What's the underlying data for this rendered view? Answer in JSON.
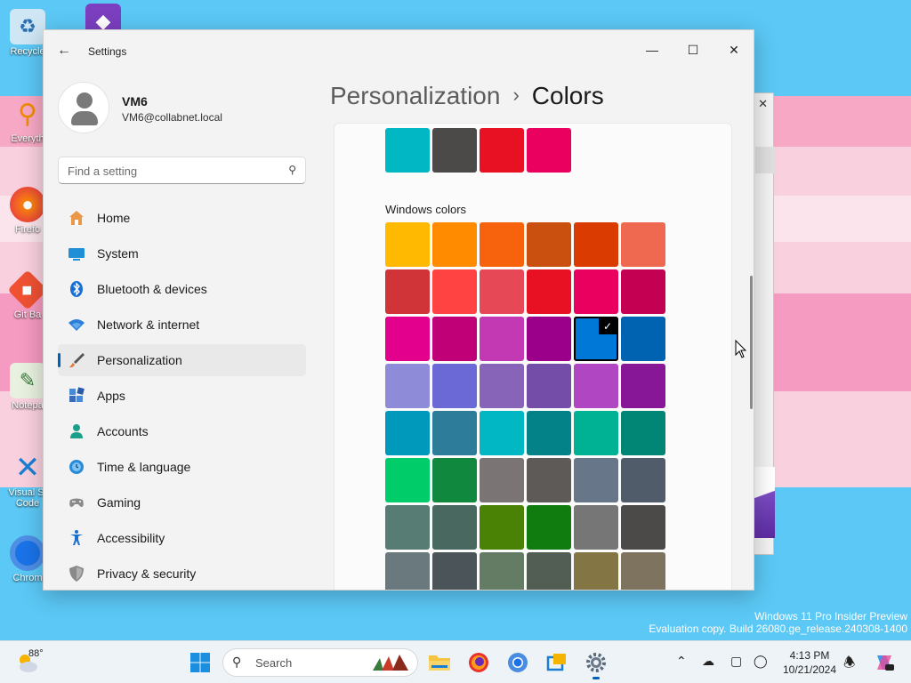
{
  "desktop": {
    "icons": [
      {
        "label": "Recycle",
        "icon": "recycle-bin-icon"
      },
      {
        "label": "Everyth",
        "icon": "everything-search-icon"
      },
      {
        "label": "Firefo",
        "icon": "firefox-icon"
      },
      {
        "label": "Git Ba",
        "icon": "git-bash-icon"
      },
      {
        "label": "Notepa",
        "icon": "notepad-icon"
      },
      {
        "label": "Visual St Code",
        "icon": "vscode-icon"
      },
      {
        "label": "Chrom",
        "icon": "chrome-icon"
      }
    ],
    "watermark": {
      "line1": "Windows 11 Pro Insider Preview",
      "line2": "Evaluation copy. Build 26080.ge_release.240308-1400"
    }
  },
  "window": {
    "title": "Settings",
    "controls": {
      "minimize": "—",
      "maximize": "☐",
      "close": "✕"
    }
  },
  "profile": {
    "name": "VM6",
    "email": "VM6@collabnet.local"
  },
  "search": {
    "placeholder": "Find a setting"
  },
  "nav": {
    "items": [
      {
        "label": "Home",
        "icon": "home-icon",
        "active": false
      },
      {
        "label": "System",
        "icon": "system-icon",
        "active": false
      },
      {
        "label": "Bluetooth & devices",
        "icon": "bluetooth-icon",
        "active": false
      },
      {
        "label": "Network & internet",
        "icon": "wifi-icon",
        "active": false
      },
      {
        "label": "Personalization",
        "icon": "brush-icon",
        "active": true
      },
      {
        "label": "Apps",
        "icon": "apps-icon",
        "active": false
      },
      {
        "label": "Accounts",
        "icon": "accounts-icon",
        "active": false
      },
      {
        "label": "Time & language",
        "icon": "globe-clock-icon",
        "active": false
      },
      {
        "label": "Gaming",
        "icon": "gamepad-icon",
        "active": false
      },
      {
        "label": "Accessibility",
        "icon": "accessibility-icon",
        "active": false
      },
      {
        "label": "Privacy & security",
        "icon": "shield-icon",
        "active": false
      }
    ]
  },
  "header": {
    "parent": "Personalization",
    "separator": "›",
    "current": "Colors"
  },
  "colors": {
    "recent": [
      "#00b7c3",
      "#4c4a48",
      "#e81123",
      "#ea005e"
    ],
    "section_label": "Windows colors",
    "selected_index": 16,
    "palette": [
      "#ffb900",
      "#ff8c00",
      "#f7630c",
      "#ca5010",
      "#da3b01",
      "#ef6950",
      "#d13438",
      "#ff4343",
      "#e74856",
      "#e81123",
      "#ea005e",
      "#c30052",
      "#e3008c",
      "#bf0077",
      "#c239b3",
      "#9a0089",
      "#0078d7",
      "#0063b1",
      "#8e8cd8",
      "#6b69d6",
      "#8764b8",
      "#744da9",
      "#b146c2",
      "#881798",
      "#0099bc",
      "#2d7d9a",
      "#00b7c3",
      "#038387",
      "#00b294",
      "#018574",
      "#00cc6a",
      "#10893e",
      "#7a7574",
      "#5d5a58",
      "#68768a",
      "#515c6b",
      "#567c73",
      "#486860",
      "#498205",
      "#107c10",
      "#767676",
      "#4c4a48",
      "#69797e",
      "#4a5459",
      "#647c64",
      "#525e54",
      "#847545",
      "#7e735f"
    ]
  },
  "taskbar": {
    "weather": {
      "temp": "88°",
      "icon": "weather-sunny-cloud-icon"
    },
    "search_label": "Search",
    "apps": [
      {
        "name": "start-button",
        "icon": "windows-start-icon"
      },
      {
        "name": "file-explorer",
        "icon": "folder-icon"
      },
      {
        "name": "firefox",
        "icon": "firefox-icon"
      },
      {
        "name": "chrome",
        "icon": "chrome-icon"
      },
      {
        "name": "remote-desktop",
        "icon": "remote-desktop-icon"
      },
      {
        "name": "settings",
        "icon": "gear-icon"
      }
    ],
    "clock": {
      "time": "4:13 PM",
      "date": "10/21/2024"
    }
  }
}
